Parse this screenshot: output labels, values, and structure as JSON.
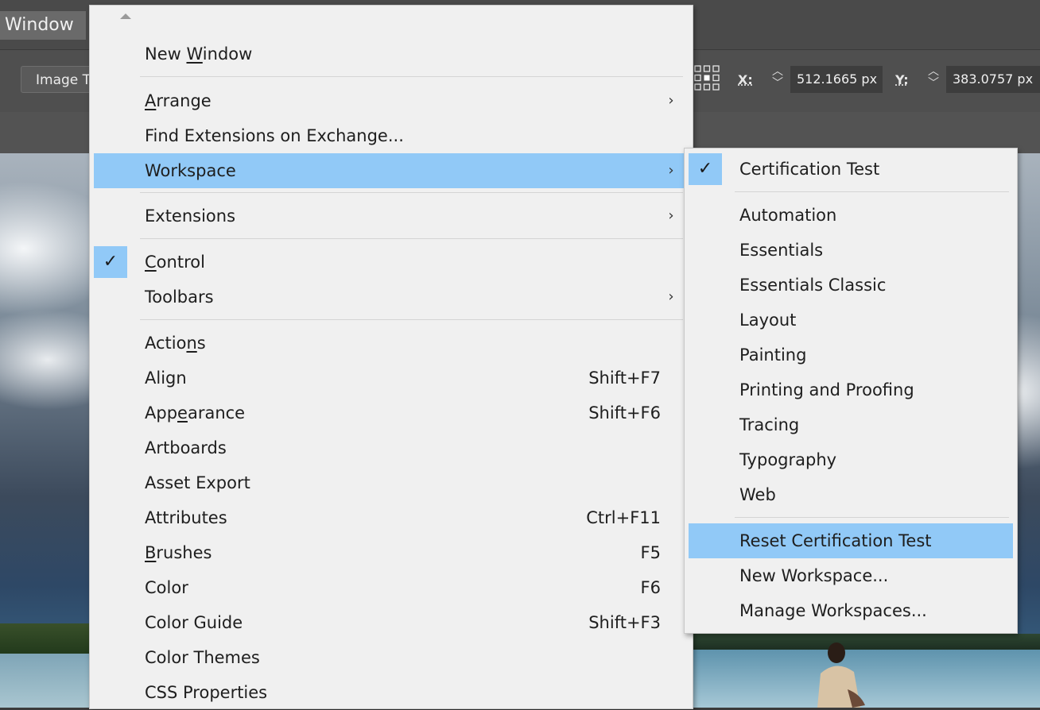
{
  "menubar": {
    "window_label": "Window"
  },
  "control_bar": {
    "image_trace_label": "Image Trace",
    "x_label": "X:",
    "x_value": "512.1665 px",
    "y_label": "Y:",
    "y_value": "383.0757 px"
  },
  "window_menu": {
    "items": [
      {
        "label_pre": "New ",
        "label_ul": "W",
        "label_post": "indow"
      },
      {
        "label_pre": "",
        "label_ul": "A",
        "label_post": "rrange",
        "submenu": true
      },
      {
        "label": "Find Extensions on Exchange..."
      },
      {
        "label": "Workspace",
        "submenu": true,
        "highlighted": true
      },
      {
        "label": "Extensions",
        "submenu": true
      },
      {
        "label_pre": "",
        "label_ul": "C",
        "label_post": "ontrol",
        "checked": true
      },
      {
        "label": "Toolbars",
        "submenu": true
      },
      {
        "label_pre": "Actio",
        "label_ul": "n",
        "label_post": "s"
      },
      {
        "label": "Align",
        "shortcut": "Shift+F7"
      },
      {
        "label_pre": "App",
        "label_ul": "e",
        "label_post": "arance",
        "shortcut": "Shift+F6"
      },
      {
        "label": "Artboards"
      },
      {
        "label": "Asset Export"
      },
      {
        "label": "Attributes",
        "shortcut": "Ctrl+F11"
      },
      {
        "label_pre": "",
        "label_ul": "B",
        "label_post": "rushes",
        "shortcut": "F5"
      },
      {
        "label": "Color",
        "shortcut": "F6"
      },
      {
        "label": "Color Guide",
        "shortcut": "Shift+F3"
      },
      {
        "label": "Color Themes"
      },
      {
        "label": "CSS Properties"
      }
    ],
    "submenu_arrow": "›",
    "check_mark": "✓"
  },
  "workspace_submenu": {
    "items": [
      {
        "label": "Certification Test",
        "checked": true
      },
      {
        "label": "Automation"
      },
      {
        "label": "Essentials"
      },
      {
        "label": "Essentials Classic"
      },
      {
        "label": "Layout"
      },
      {
        "label": "Painting"
      },
      {
        "label": "Printing and Proofing"
      },
      {
        "label": "Tracing"
      },
      {
        "label": "Typography"
      },
      {
        "label": "Web"
      },
      {
        "label": "Reset Certification Test",
        "highlighted": true
      },
      {
        "label": "New Workspace..."
      },
      {
        "label": "Manage Workspaces..."
      }
    ]
  },
  "colors": {
    "highlight": "#91c9f7",
    "menu_bg": "#f0f0f0"
  }
}
